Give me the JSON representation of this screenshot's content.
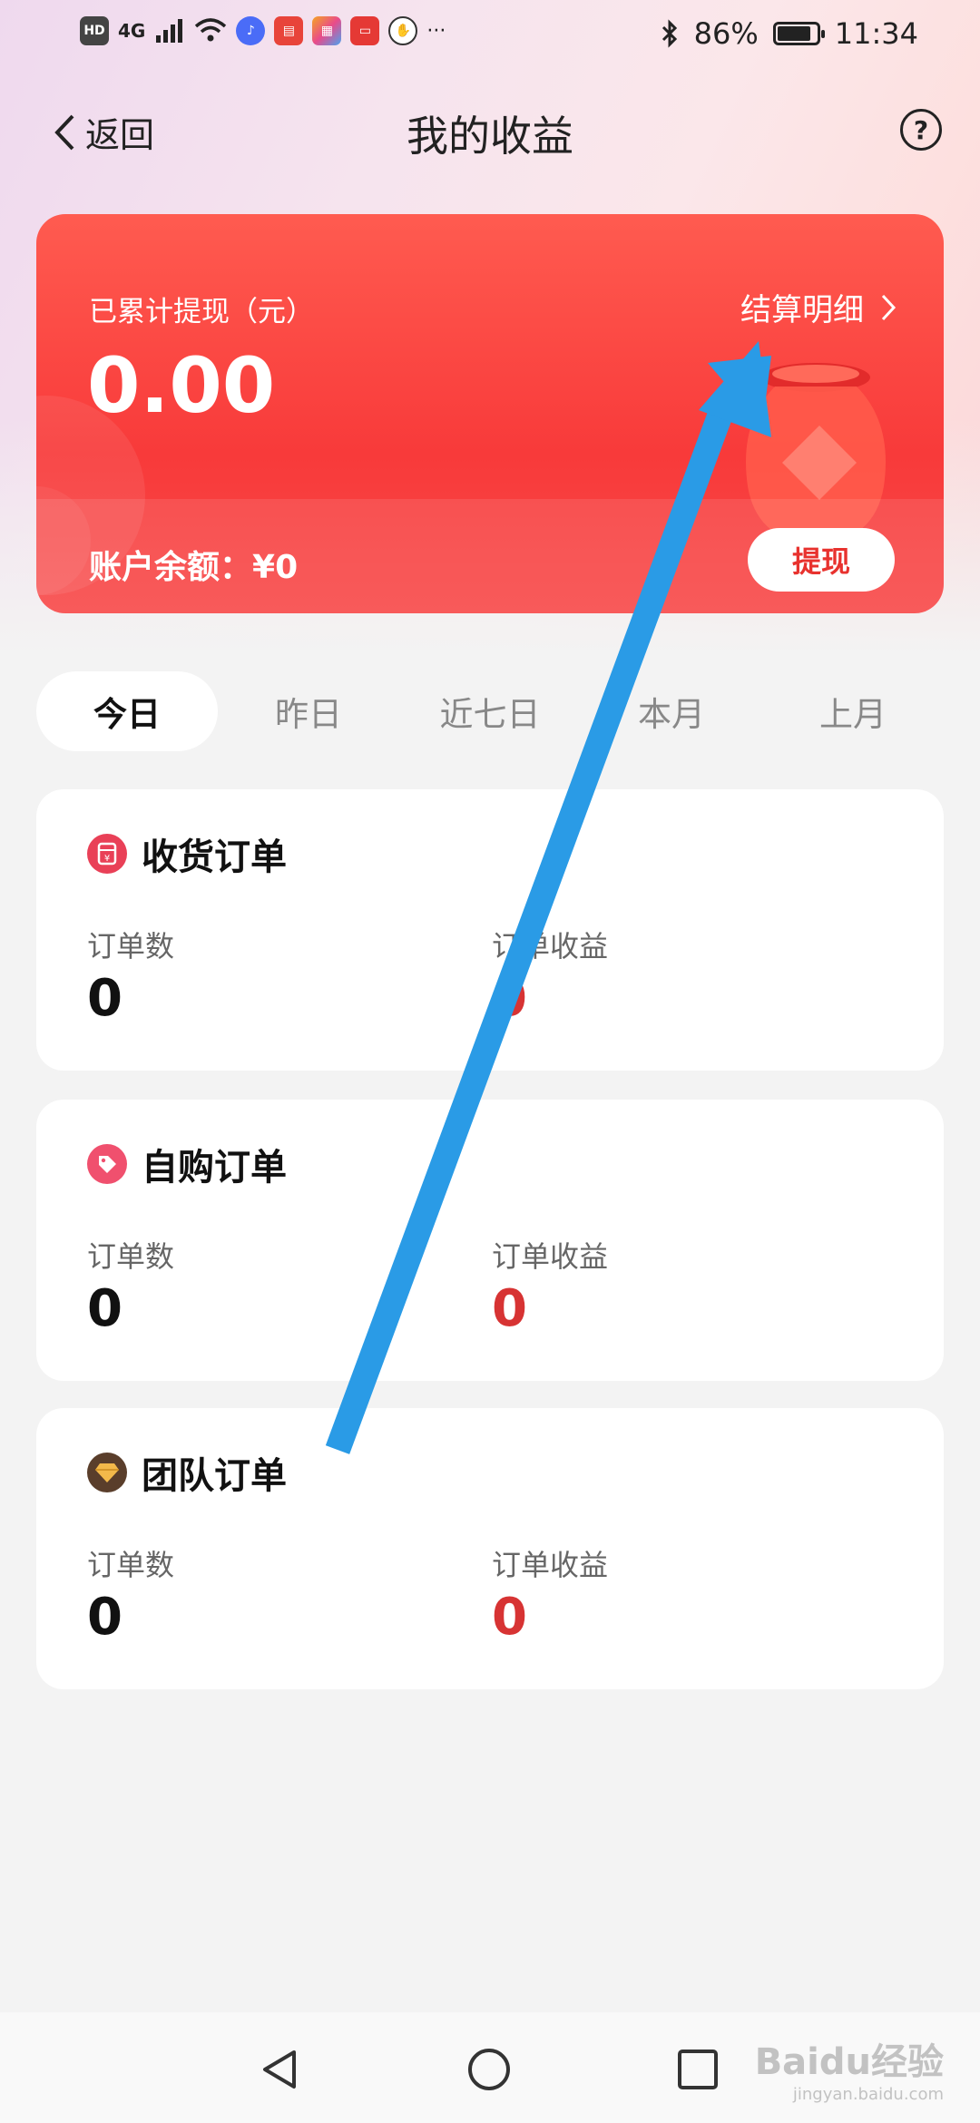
{
  "status_bar": {
    "network": "4G",
    "battery": "86%",
    "battery_level": 0.86,
    "time": "11:34",
    "more": "···"
  },
  "nav": {
    "back_label": "返回",
    "title": "我的收益",
    "help_symbol": "?"
  },
  "earnings_card": {
    "cumulative_label": "已累计提现（元）",
    "cumulative_amount": "0.00",
    "settlement_link": "结算明细",
    "balance_label": "账户余额：",
    "balance_value": "¥0",
    "withdraw_button": "提现"
  },
  "tabs": [
    {
      "label": "今日",
      "active": true
    },
    {
      "label": "昨日",
      "active": false
    },
    {
      "label": "近七日",
      "active": false
    },
    {
      "label": "本月",
      "active": false
    },
    {
      "label": "上月",
      "active": false
    }
  ],
  "order_cards": [
    {
      "title": "收货订单",
      "icon": "receipt-icon",
      "count_label": "订单数",
      "count": "0",
      "earnings_label": "订单收益",
      "earnings": "0"
    },
    {
      "title": "自购订单",
      "icon": "tag-icon",
      "count_label": "订单数",
      "count": "0",
      "earnings_label": "订单收益",
      "earnings": "0"
    },
    {
      "title": "团队订单",
      "icon": "diamond-icon",
      "count_label": "订单数",
      "count": "0",
      "earnings_label": "订单收益",
      "earnings": "0"
    }
  ],
  "watermark": {
    "text": "Baidu经验",
    "sub": "jingyan.baidu.com"
  },
  "colors": {
    "accent": "#f83a3a",
    "earnings_red": "#d73333",
    "annotation_arrow": "#2a9be6"
  }
}
